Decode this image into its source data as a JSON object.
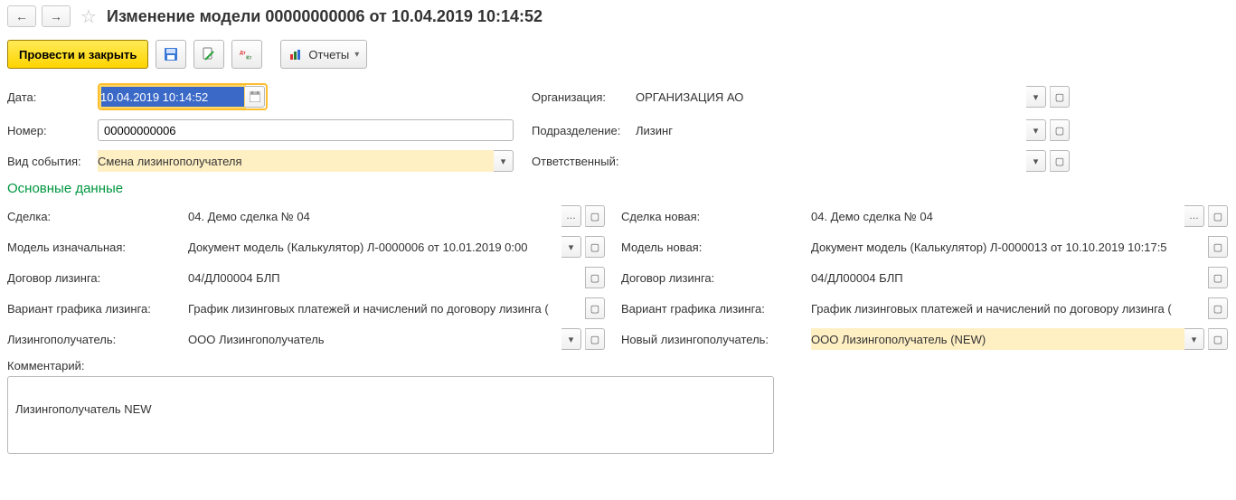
{
  "header": {
    "title": "Изменение модели 00000000006 от 10.04.2019 10:14:52"
  },
  "toolbar": {
    "post_close": "Провести и закрыть",
    "reports": "Отчеты"
  },
  "form": {
    "date_label": "Дата:",
    "date_value": "10.04.2019 10:14:52",
    "number_label": "Номер:",
    "number_value": "00000000006",
    "event_type_label": "Вид события:",
    "event_type_value": "Смена лизингополучателя",
    "org_label": "Организация:",
    "org_value": "ОРГАНИЗАЦИЯ АО",
    "division_label": "Подразделение:",
    "division_value": "Лизинг",
    "responsible_label": "Ответственный:",
    "responsible_value": ""
  },
  "section_title": "Основные данные",
  "main": {
    "deal_label": "Сделка:",
    "deal_value": "04. Демо сделка № 04",
    "deal_new_label": "Сделка новая:",
    "deal_new_value": "04. Демо сделка № 04",
    "model_orig_label": "Модель изначальная:",
    "model_orig_value": "Документ модель (Калькулятор) Л-0000006 от 10.01.2019 0:00",
    "model_new_label": "Модель новая:",
    "model_new_value": "Документ модель (Калькулятор) Л-0000013 от 10.10.2019 10:17:5",
    "contract_label": "Договор лизинга:",
    "contract_value": "04/ДЛ00004 БЛП",
    "contract_label_r": "Договор лизинга:",
    "contract_value_r": "04/ДЛ00004 БЛП",
    "schedule_label": "Вариант графика лизинга:",
    "schedule_value": "График лизинговых платежей и начислений по договору лизинга (",
    "schedule_label_r": "Вариант графика лизинга:",
    "schedule_value_r": "График лизинговых платежей и начислений по договору лизинга (",
    "lessee_label": "Лизингополучатель:",
    "lessee_value": "ООО Лизингополучатель",
    "lessee_new_label": "Новый лизингополучатель:",
    "lessee_new_value": "ООО Лизингополучатель (NEW)",
    "comment_label": "Комментарий:",
    "comment_value": "Лизингополучатель NEW"
  }
}
